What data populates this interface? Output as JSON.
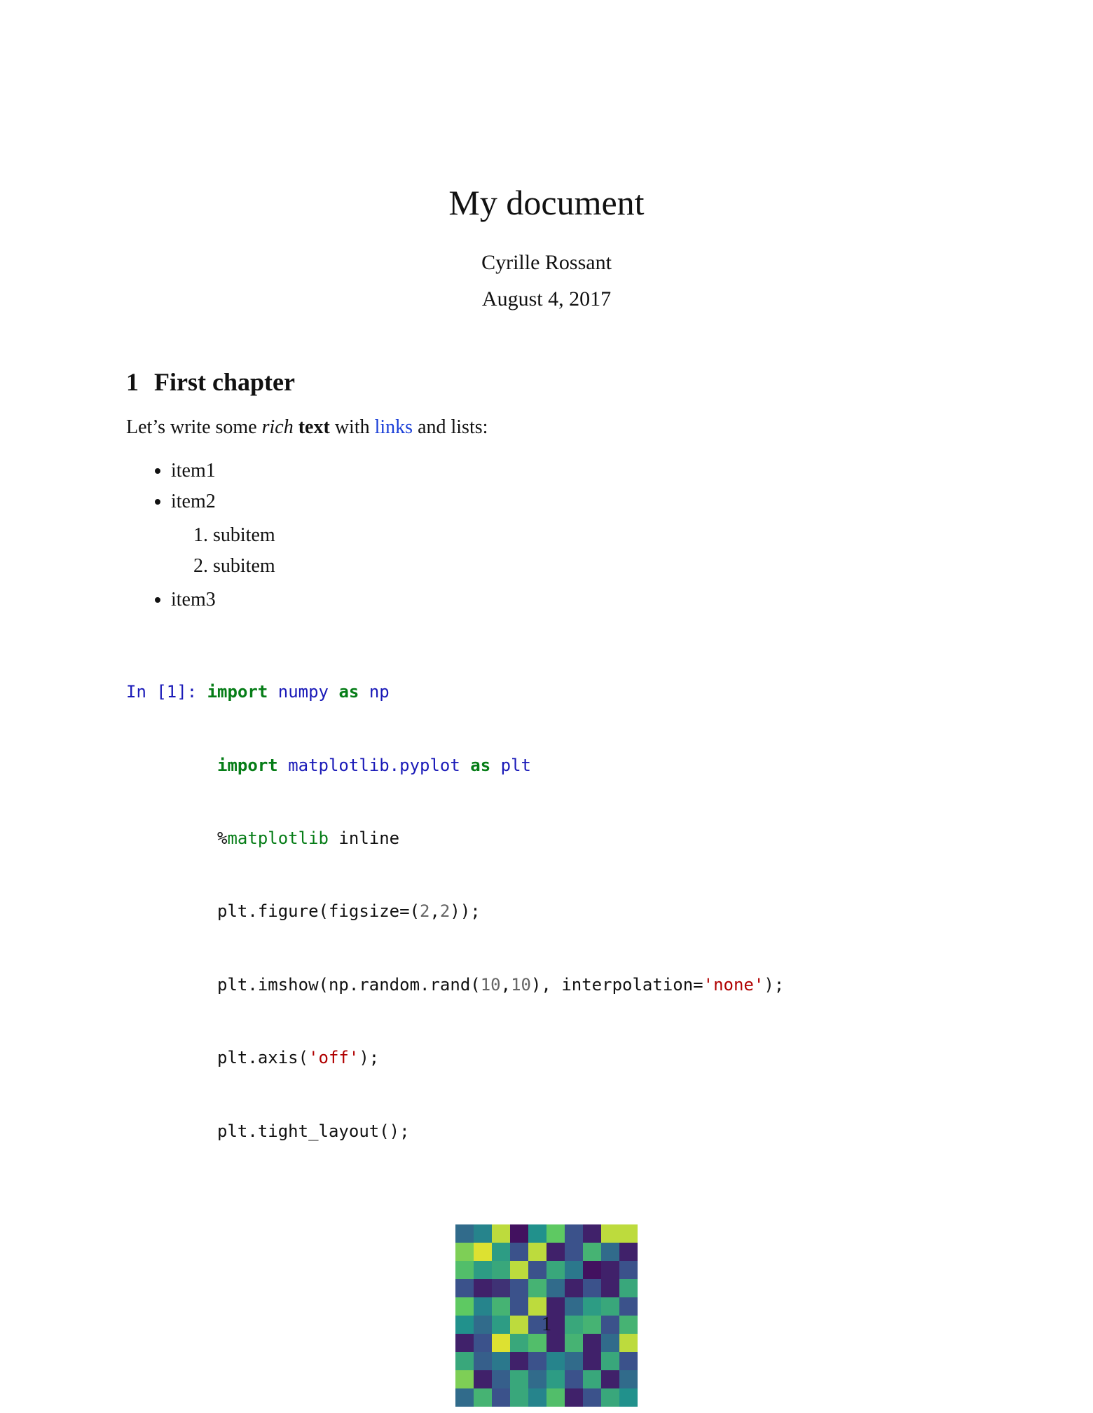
{
  "title": "My document",
  "author": "Cyrille Rossant",
  "date": "August 4, 2017",
  "section": {
    "number": "1",
    "title": "First chapter"
  },
  "paragraph": {
    "prefix": "Let’s write some ",
    "rich": "rich",
    "space1": " ",
    "bold": "text",
    "mid": " with ",
    "link": "links",
    "suffix": " and lists:"
  },
  "list": {
    "item1": "item1",
    "item2": "item2",
    "sub1": "subitem",
    "sub2": "subitem",
    "item3": "item3"
  },
  "code": {
    "prompt": "In [1]: ",
    "line1_kw": "import ",
    "line1_pkg": "numpy ",
    "line1_as": "as ",
    "line1_alias": "np",
    "line2_kw": "import ",
    "line2_pkg": "matplotlib.pyplot ",
    "line2_as": "as ",
    "line2_alias": "plt",
    "line3_pct": "%",
    "line3_magic": "matplotlib",
    "line3_arg": " inline",
    "line4_a": "plt.figure(figsize=(",
    "line4_n1": "2",
    "line4_comma": ",",
    "line4_n2": "2",
    "line4_b": "));",
    "line5_a": "plt.imshow(np.random.rand(",
    "line5_n1": "10",
    "line5_comma": ",",
    "line5_n2": "10",
    "line5_b": "), interpolation=",
    "line5_str": "'none'",
    "line5_c": ");",
    "line6_a": "plt.axis(",
    "line6_str": "'off'",
    "line6_b": ");",
    "line7": "plt.tight_layout();"
  },
  "page_number": "1",
  "chart_data": {
    "type": "heatmap",
    "title": "",
    "xlabel": "",
    "ylabel": "",
    "rows": 10,
    "cols": 10,
    "colormap": "viridis",
    "range": [
      0,
      1
    ],
    "values": [
      [
        0.35,
        0.45,
        0.9,
        0.05,
        0.5,
        0.75,
        0.25,
        0.1,
        0.9,
        0.9
      ],
      [
        0.8,
        0.95,
        0.55,
        0.25,
        0.9,
        0.1,
        0.25,
        0.65,
        0.35,
        0.1
      ],
      [
        0.7,
        0.55,
        0.6,
        0.9,
        0.25,
        0.6,
        0.4,
        0.05,
        0.1,
        0.25
      ],
      [
        0.25,
        0.1,
        0.15,
        0.25,
        0.65,
        0.35,
        0.1,
        0.25,
        0.1,
        0.6
      ],
      [
        0.75,
        0.45,
        0.65,
        0.25,
        0.9,
        0.1,
        0.35,
        0.55,
        0.6,
        0.25
      ],
      [
        0.5,
        0.35,
        0.55,
        0.9,
        0.25,
        0.1,
        0.6,
        0.65,
        0.25,
        0.65
      ],
      [
        0.1,
        0.25,
        0.95,
        0.6,
        0.7,
        0.1,
        0.65,
        0.1,
        0.35,
        0.9
      ],
      [
        0.6,
        0.3,
        0.4,
        0.1,
        0.25,
        0.45,
        0.35,
        0.1,
        0.6,
        0.25
      ],
      [
        0.8,
        0.1,
        0.3,
        0.6,
        0.35,
        0.55,
        0.25,
        0.6,
        0.1,
        0.35
      ],
      [
        0.35,
        0.65,
        0.25,
        0.6,
        0.45,
        0.7,
        0.1,
        0.25,
        0.6,
        0.5
      ]
    ]
  }
}
